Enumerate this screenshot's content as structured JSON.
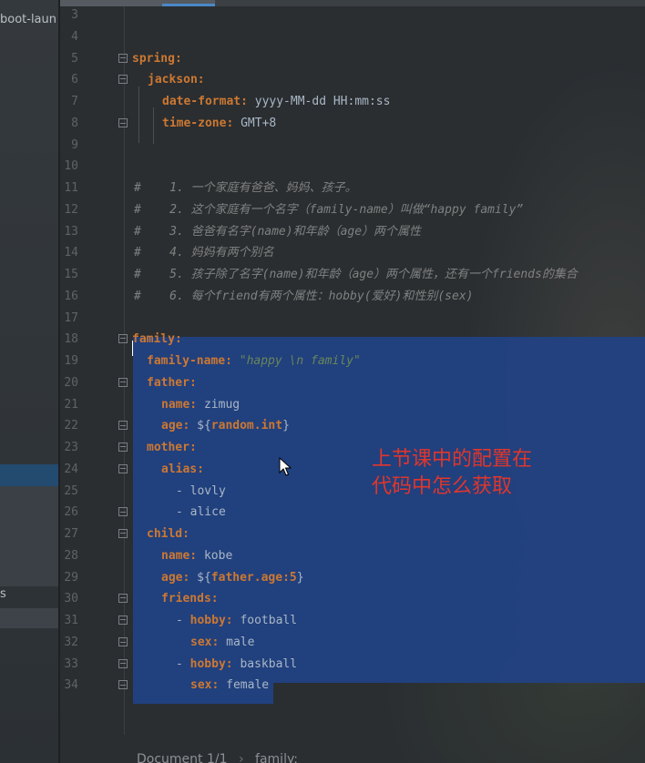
{
  "project_tree": {
    "project_label": "boot-laun",
    "visible_item_label": "s"
  },
  "editor": {
    "lines": [
      {
        "n": "3"
      },
      {
        "n": "4"
      },
      {
        "n": "5",
        "key": "spring:"
      },
      {
        "n": "6",
        "key": "jackson:"
      },
      {
        "n": "7",
        "key": "date-format:",
        "value": " yyyy-MM-dd HH:mm:ss"
      },
      {
        "n": "8",
        "key": "time-zone:",
        "value": " GMT+8"
      },
      {
        "n": "9"
      },
      {
        "n": "10"
      },
      {
        "n": "11",
        "comment": "#    1. 一个家庭有爸爸、妈妈、孩子。"
      },
      {
        "n": "12",
        "comment": "#    2. 这个家庭有一个名字（family-name）叫做“happy family”"
      },
      {
        "n": "13",
        "comment": "#    3. 爸爸有名字(name)和年龄（age）两个属性"
      },
      {
        "n": "14",
        "comment": "#    4. 妈妈有两个别名"
      },
      {
        "n": "15",
        "comment": "#    5. 孩子除了名字(name)和年龄（age）两个属性，还有一个friends的集合"
      },
      {
        "n": "16",
        "comment": "#    6. 每个friend有两个属性：hobby(爱好)和性别(sex)"
      },
      {
        "n": "17"
      },
      {
        "n": "18",
        "key": "family:"
      },
      {
        "n": "19",
        "key": "family-name:",
        "str": " \"happy \\n family\""
      },
      {
        "n": "20",
        "key": "father:"
      },
      {
        "n": "21",
        "key": "name:",
        "value": " zimug"
      },
      {
        "n": "22",
        "key": "age:",
        "tpl_open": " ${",
        "tpl_key": "random.int",
        "tpl_close": "}"
      },
      {
        "n": "23",
        "key": "mother:"
      },
      {
        "n": "24",
        "key": "alias:"
      },
      {
        "n": "25",
        "dash": "- ",
        "value": "lovly"
      },
      {
        "n": "26",
        "dash": "- ",
        "value": "alice"
      },
      {
        "n": "27",
        "key": "child:"
      },
      {
        "n": "28",
        "key": "name:",
        "value": " kobe"
      },
      {
        "n": "29",
        "key": "age:",
        "tpl_open": " ${",
        "tpl_key": "father.age:5",
        "tpl_close": "}"
      },
      {
        "n": "30",
        "key": "friends:"
      },
      {
        "n": "31",
        "dash": "- ",
        "key": "hobby:",
        "value": " football"
      },
      {
        "n": "32",
        "key": "sex:",
        "value": " male"
      },
      {
        "n": "33",
        "dash": "- ",
        "key": "hobby:",
        "value": " baskball"
      },
      {
        "n": "34",
        "key": "sex:",
        "value": " female"
      }
    ]
  },
  "annotation": {
    "line1": "上节课中的配置在",
    "line2": "代码中怎么获取"
  },
  "status_bar": {
    "document": "Document 1/1",
    "path": "family:"
  },
  "colors": {
    "key": "#cc7832",
    "value": "#a9b7c6",
    "comment": "#808080",
    "selection": "#214283",
    "annotation": "#e0362b"
  }
}
